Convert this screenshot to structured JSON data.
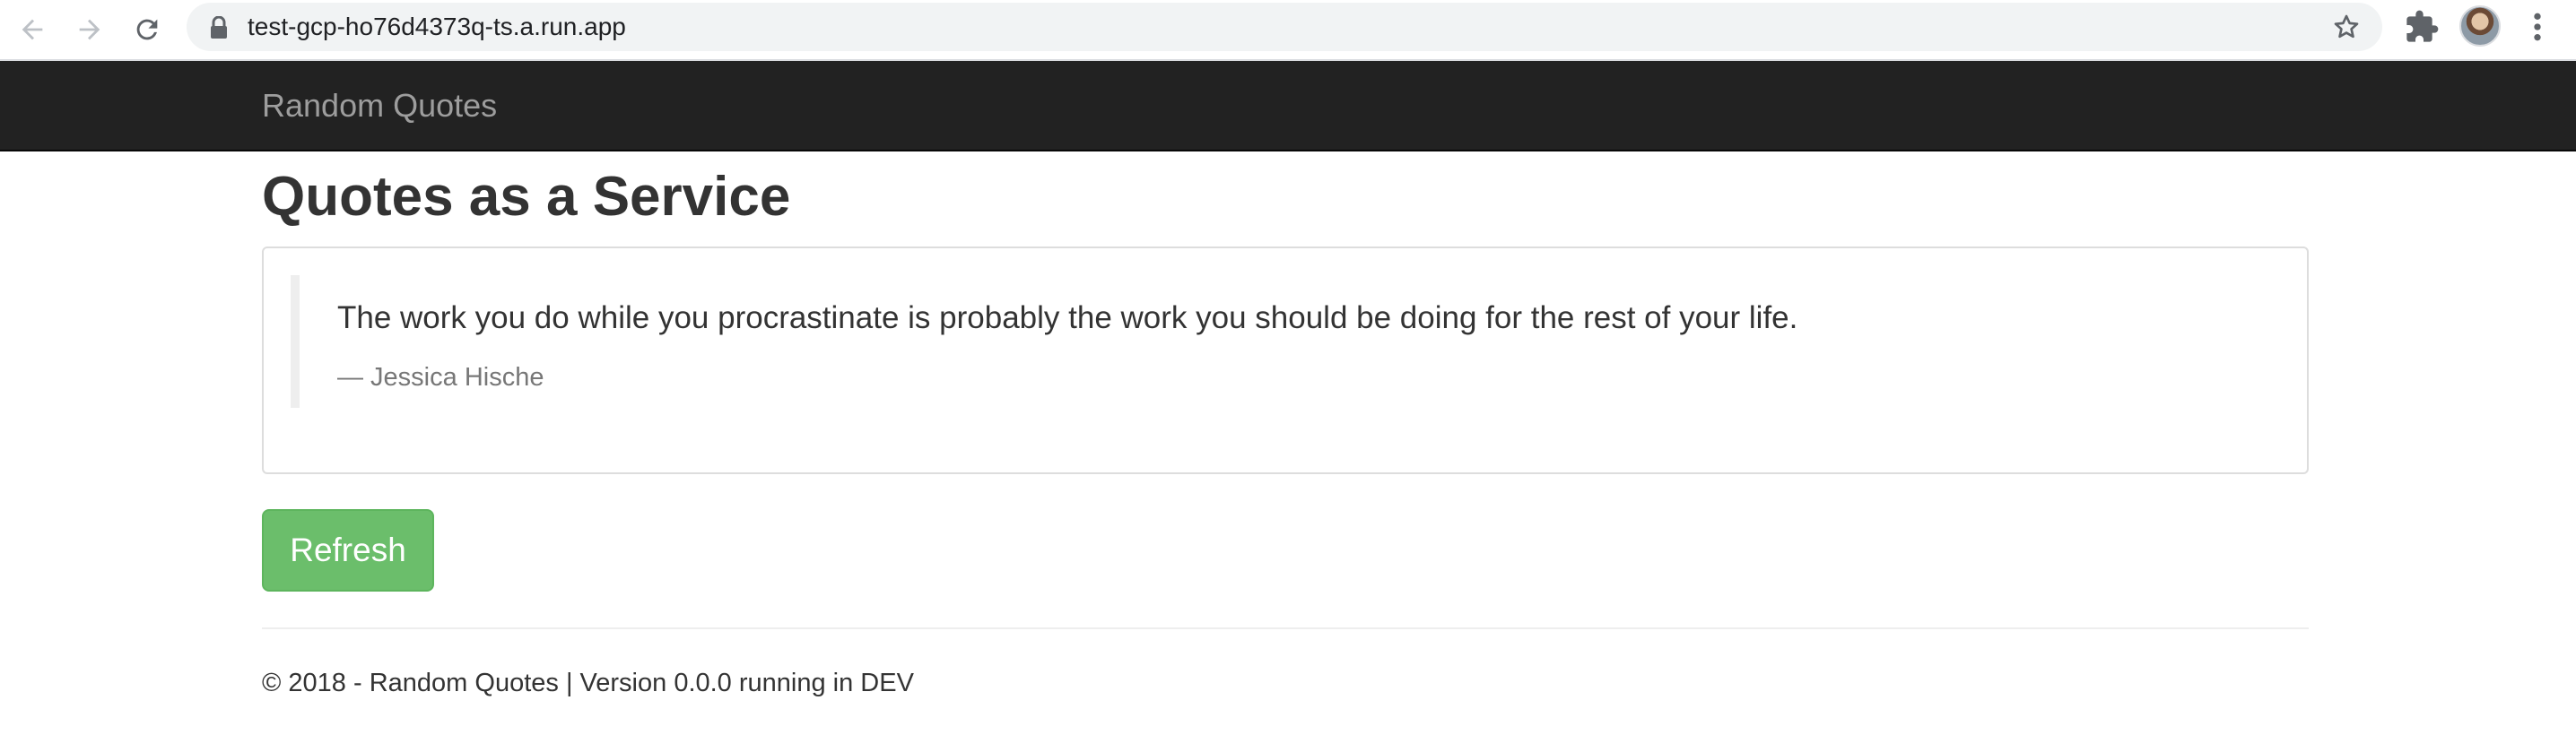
{
  "browser": {
    "url": "test-gcp-ho76d4373q-ts.a.run.app",
    "icons": {
      "back": "arrow-back-icon",
      "forward": "arrow-forward-icon",
      "reload": "reload-icon",
      "lock": "lock-icon",
      "bookmark": "star-icon",
      "extensions": "puzzle-icon",
      "menu": "kebab-menu-icon"
    }
  },
  "navbar": {
    "brand": "Random Quotes",
    "background": "#222222",
    "brand_color": "#9d9d9d"
  },
  "main": {
    "title": "Quotes as a Service",
    "quote": {
      "text": "The work you do while you procrastinate is probably the work you should be doing for the rest of your life.",
      "author": "— Jessica Hische"
    },
    "refresh_label": "Refresh",
    "button_color": "#5cb85c"
  },
  "footer": {
    "text": "© 2018 - Random Quotes | Version 0.0.0 running in DEV"
  }
}
